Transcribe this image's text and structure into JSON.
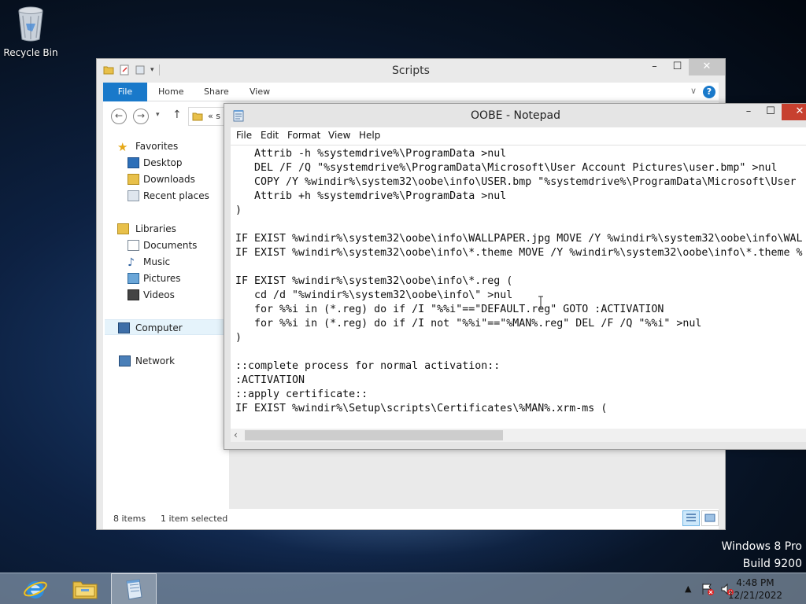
{
  "desktop": {
    "recycle_bin_label": "Recycle Bin",
    "watermark_edition": "Windows 8 Pro",
    "watermark_build": "Build 9200"
  },
  "explorer": {
    "title": "Scripts",
    "tabs": {
      "file": "File",
      "home": "Home",
      "share": "Share",
      "view": "View"
    },
    "address_prefix": "«",
    "address_text": "s",
    "nav": {
      "favorites": "Favorites",
      "desktop": "Desktop",
      "downloads": "Downloads",
      "recent_places": "Recent places",
      "libraries": "Libraries",
      "documents": "Documents",
      "music": "Music",
      "pictures": "Pictures",
      "videos": "Videos",
      "computer": "Computer",
      "network": "Network"
    },
    "status": {
      "items_count": "8 items",
      "selection": "1 item selected"
    }
  },
  "notepad": {
    "title": "OOBE - Notepad",
    "menu": {
      "file": "File",
      "edit": "Edit",
      "format": "Format",
      "view": "View",
      "help": "Help"
    },
    "lines": [
      "   Attrib -h %systemdrive%\\ProgramData >nul",
      "   DEL /F /Q \"%systemdrive%\\ProgramData\\Microsoft\\User Account Pictures\\user.bmp\" >nul",
      "   COPY /Y %windir%\\system32\\oobe\\info\\USER.bmp \"%systemdrive%\\ProgramData\\Microsoft\\User",
      "   Attrib +h %systemdrive%\\ProgramData >nul",
      ")",
      "",
      "IF EXIST %windir%\\system32\\oobe\\info\\WALLPAPER.jpg MOVE /Y %windir%\\system32\\oobe\\info\\WAL",
      "IF EXIST %windir%\\system32\\oobe\\info\\*.theme MOVE /Y %windir%\\system32\\oobe\\info\\*.theme %",
      "",
      "IF EXIST %windir%\\system32\\oobe\\info\\*.reg (",
      "   cd /d \"%windir%\\system32\\oobe\\info\\\" >nul",
      "   for %%i in (*.reg) do if /I \"%%i\"==\"DEFAULT.reg\" GOTO :ACTIVATION",
      "   for %%i in (*.reg) do if /I not \"%%i\"==\"%MAN%.reg\" DEL /F /Q \"%%i\" >nul",
      ")",
      "",
      "::complete process for normal activation::",
      ":ACTIVATION",
      "::apply certificate::",
      "IF EXIST %windir%\\Setup\\scripts\\Certificates\\%MAN%.xrm-ms ("
    ]
  },
  "taskbar": {
    "time": "4:48 PM",
    "date": "12/21/2022"
  },
  "icons": {
    "recycle_bin": "recycle-bin-icon",
    "ie": "internet-explorer-icon",
    "file_explorer": "file-explorer-icon",
    "notepad": "notepad-icon"
  },
  "colors": {
    "ribbon_file_tab": "#1979ca",
    "close_button_active": "#c7402f",
    "selection_highlight": "#e5f3fb"
  }
}
